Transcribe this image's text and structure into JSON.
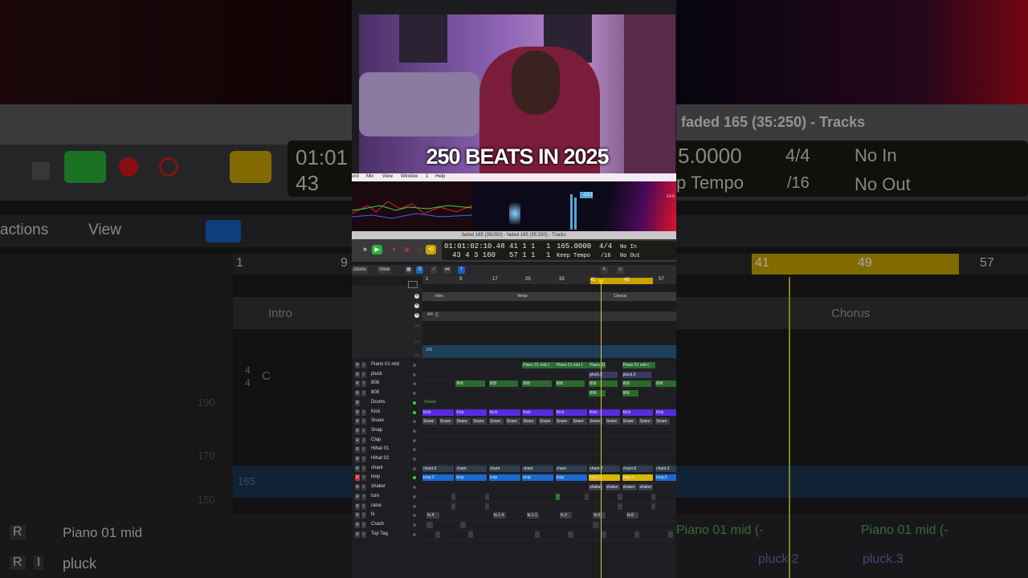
{
  "video": {
    "caption": "250 BEATS IN 2025"
  },
  "menubar": {
    "items": [
      "ord",
      "Mix",
      "View",
      "Window",
      "1",
      "Help"
    ]
  },
  "meters": {
    "lufs_label": "-13.5LU",
    "right_label": "-14.6"
  },
  "window": {
    "title": "faded 165 (35/250) - faded 165 (35:250) - Tracks"
  },
  "transport": {
    "time": "01:01:02:10.48",
    "bars": "41  1  1",
    "beat": "1",
    "bars2": "43  4  3  160",
    "bars2b": "57  1  1",
    "beat2": "1",
    "tempo": "165.0000",
    "tempo_mode": "Keep Tempo",
    "sig": "4/4",
    "div": "/16",
    "in": "No In",
    "out": "No Out"
  },
  "toolbar": {
    "functions": "ctions",
    "view": "View"
  },
  "ruler": {
    "marks": [
      "1",
      "9",
      "17",
      "25",
      "33",
      "41",
      "49",
      "57"
    ]
  },
  "markers": {
    "intro": "Intro",
    "verse": "Verse",
    "chorus": "Chorus"
  },
  "signature": {
    "value": "4/4",
    "key": "C"
  },
  "tempo_track": {
    "value": "165",
    "scale_hi": "190",
    "scale_mid": "170",
    "scale_lo": "150"
  },
  "tracks": [
    {
      "name": "Piano 01 mid",
      "color": "#2a7a3a"
    },
    {
      "name": "pluck",
      "color": "#3a3a5a"
    },
    {
      "name": "808",
      "color": "#2a6a2a"
    },
    {
      "name": "808",
      "color": "#2a6a2a"
    },
    {
      "name": "Drums",
      "color": "#3a8a3a"
    },
    {
      "name": "Kick",
      "color": "#5a2ae0"
    },
    {
      "name": "Snare",
      "color": "#3a3a46"
    },
    {
      "name": "Snap",
      "color": "#3a3a46"
    },
    {
      "name": "Clap",
      "color": "#3a3a46"
    },
    {
      "name": "Hihat 01",
      "color": "#3a3a46"
    },
    {
      "name": "Hihat 02",
      "color": "#3a3a46"
    },
    {
      "name": "chant",
      "color": "#3a4a5a"
    },
    {
      "name": "loop",
      "color": "#1a6ad0"
    },
    {
      "name": "shaker",
      "color": "#3a3a46"
    },
    {
      "name": "tom",
      "color": "#3a3a46"
    },
    {
      "name": "raise",
      "color": "#3a3a46"
    },
    {
      "name": "fx",
      "color": "#3a3a46"
    },
    {
      "name": "Crash",
      "color": "#3a3a46"
    },
    {
      "name": "Top Tag",
      "color": "#3a3a46"
    }
  ],
  "regions": {
    "piano": [
      "Piano 01 mid (-",
      "Piano 01 mid (-",
      "Piano 01 mid (-",
      "Piano 01 mid (-"
    ],
    "pluck": [
      "pluck.2",
      "pluck.3"
    ],
    "r808": "808",
    "drums_label": "Drums",
    "kick": "Kick",
    "snare": "Snare",
    "chant": [
      "chant.5",
      "chant",
      "chant",
      "chant",
      "chant",
      "chant.7",
      "chant.8",
      "chant.9"
    ],
    "loop": [
      "loop.2",
      "loop",
      "loop",
      "loop",
      "loop",
      "loop.3",
      "loop.4",
      "loop.5"
    ],
    "shaker": "shaker",
    "fx": [
      "fx.4",
      "fx.1.4",
      "fx.1.1",
      "fx.2",
      "fx.5",
      "fx.6"
    ]
  },
  "background": {
    "time": "01:01",
    "bars": "43",
    "tempo": "5.0000",
    "tempo_mode": "p Tempo",
    "sig": "4/4",
    "div": "/16",
    "in": "No In",
    "out": "No Out",
    "title": "faded 165 (35:250) - Tracks",
    "functions": "actions",
    "view": "View",
    "bar_left": "1",
    "bar_mid": "9",
    "bar_41": "41",
    "bar_49": "49",
    "bar_57": "57",
    "intro": "Intro",
    "chorus": "Chorus",
    "sig_num": "4",
    "sig_den": "4",
    "key": "C",
    "t190": "190",
    "t170": "170",
    "t150": "150",
    "t165": "165",
    "track1": "Piano 01 mid",
    "track2": "pluck",
    "region1": "Piano 01 mid (-",
    "region2": "Piano 01 mid (-",
    "region3": "pluck.2",
    "region4": "pluck.3",
    "r": "R",
    "i": "I"
  }
}
